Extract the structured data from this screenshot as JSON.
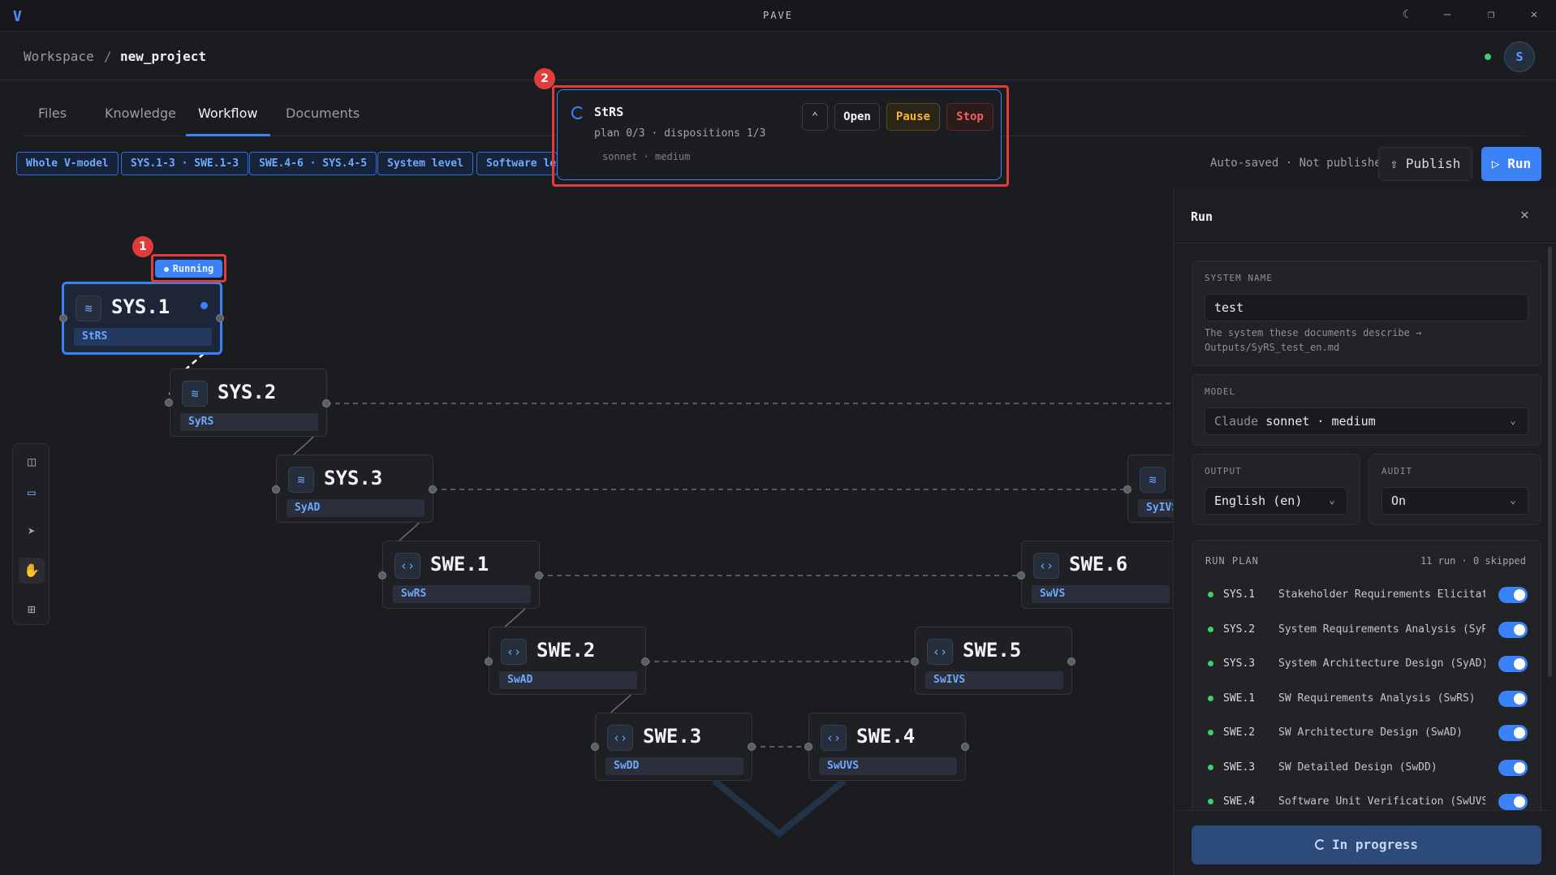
{
  "app": {
    "title": "PAVE",
    "logo_icon": "v-logo-icon"
  },
  "window_controls": [
    "theme-toggle-icon",
    "minimize-icon",
    "maximize-icon",
    "close-icon"
  ],
  "breadcrumb": {
    "workspace": "Workspace",
    "separator": "/",
    "project": "new_project"
  },
  "user": {
    "avatar_initial": "S",
    "status_color": "#3fcf6b"
  },
  "tabs": [
    {
      "label": "Files",
      "active": false
    },
    {
      "label": "Knowledge",
      "active": false
    },
    {
      "label": "Workflow",
      "active": true
    },
    {
      "label": "Documents",
      "active": false
    }
  ],
  "filters": [
    {
      "label": "Whole V-model"
    },
    {
      "label": "SYS.1-3 · SWE.1-3"
    },
    {
      "label": "SWE.4-6 · SYS.4-5"
    },
    {
      "label": "System level"
    },
    {
      "label": "Software level"
    }
  ],
  "toolbar": {
    "autosave_text": "Auto-saved · Not published",
    "publish_label": "Publish",
    "run_label": "Run"
  },
  "nodes": [
    {
      "id": "SYS.1",
      "doc": "StRS",
      "icon": "layers-icon",
      "state": "running"
    },
    {
      "id": "SYS.2",
      "doc": "SyRS",
      "icon": "layers-icon"
    },
    {
      "id": "SYS.3",
      "doc": "SyAD",
      "icon": "layers-icon"
    },
    {
      "id": "SWE.1",
      "doc": "SwRS",
      "icon": "code-icon"
    },
    {
      "id": "SWE.2",
      "doc": "SwAD",
      "icon": "code-icon"
    },
    {
      "id": "SWE.3",
      "doc": "SwDD",
      "icon": "code-icon"
    },
    {
      "id": "SWE.4",
      "doc": "SwUVS",
      "icon": "code-icon"
    },
    {
      "id": "SWE.5",
      "doc": "SwIVS",
      "icon": "code-icon"
    },
    {
      "id": "SWE.6",
      "doc": "SwVS",
      "icon": "code-icon"
    },
    {
      "id": "",
      "doc": "SyIVS",
      "icon": "layers-icon"
    }
  ],
  "running_badge": "Running",
  "annotations": [
    "1",
    "2"
  ],
  "tool_rail": [
    "panel-toggle-icon",
    "document-icon",
    "pointer-icon",
    "hand-icon",
    "grid-icon"
  ],
  "popup": {
    "title": "StRS",
    "progress": "plan 0/3 · dispositions 1/3",
    "model": "sonnet · medium",
    "open_label": "Open",
    "pause_label": "Pause",
    "stop_label": "Stop"
  },
  "panel": {
    "title": "Run",
    "system_name": {
      "label": "SYSTEM NAME",
      "value": "test",
      "helper": "The system these documents describe → Outputs/SyRS_test_en.md"
    },
    "model": {
      "label": "MODEL",
      "vendor": "Claude",
      "value": "sonnet · medium"
    },
    "output": {
      "label": "OUTPUT",
      "value": "English (en)"
    },
    "audit": {
      "label": "AUDIT",
      "value": "On"
    },
    "run_plan": {
      "label": "RUN PLAN",
      "summary": "11 run · 0 skipped",
      "items": [
        {
          "id": "SYS.1",
          "name": "Stakeholder Requirements Elicitat…",
          "enabled": true
        },
        {
          "id": "SYS.2",
          "name": "System Requirements Analysis (SyR…",
          "enabled": true
        },
        {
          "id": "SYS.3",
          "name": "System Architecture Design (SyAD)",
          "enabled": true
        },
        {
          "id": "SWE.1",
          "name": "SW Requirements Analysis (SwRS)",
          "enabled": true
        },
        {
          "id": "SWE.2",
          "name": "SW Architecture Design (SwAD)",
          "enabled": true
        },
        {
          "id": "SWE.3",
          "name": "SW Detailed Design (SwDD)",
          "enabled": true
        },
        {
          "id": "SWE.4",
          "name": "Software Unit Verification (SwUVS)",
          "enabled": true
        }
      ]
    },
    "progress_label": "In progress"
  },
  "colors": {
    "accent": "#3b82f6",
    "pause": "#f5b52e",
    "stop": "#f26060",
    "ok": "#3fcf6b"
  }
}
